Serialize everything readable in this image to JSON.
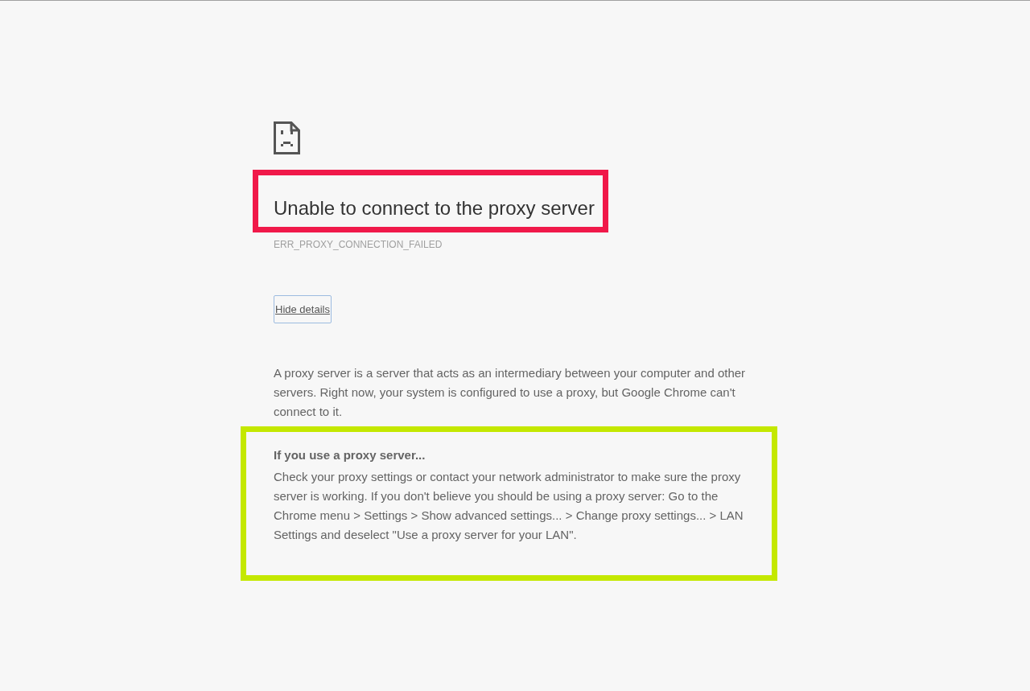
{
  "heading": {
    "text": "Unable to connect to the proxy server",
    "highlight": {
      "color": "#f0194a"
    }
  },
  "error_code": "ERR_PROXY_CONNECTION_FAILED",
  "details_button": {
    "label": "Hide details"
  },
  "explanation": "A proxy server is a server that acts as an intermediary between your computer and other servers. Right now, your system is configured to use a proxy, but Google Chrome can't connect to it.",
  "help_section": {
    "title": "If you use a proxy server...",
    "body": "Check your proxy settings or contact your network administrator to make sure the proxy server is working. If you don't believe you should be using a proxy server: Go to the Chrome menu > Settings > Show advanced settings... > Change proxy settings... > LAN Settings and deselect \"Use a proxy server for your LAN\".",
    "highlight": {
      "color": "#c4e800"
    }
  }
}
